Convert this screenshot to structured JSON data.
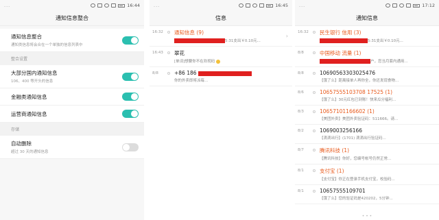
{
  "screen1": {
    "status": {
      "left": "...",
      "time": "16:44"
    },
    "title": "通知信息整合",
    "rows": [
      {
        "title": "通知信息整合",
        "sub": "通知类信息将会合在一个单独的信息列表中",
        "toggle": "on"
      }
    ],
    "section_merge": "整合设置",
    "merge_rows": [
      {
        "title": "大部分国内通知信息",
        "sub": "106、400 等开头的信息",
        "toggle": "on"
      },
      {
        "title": "金融类通知信息",
        "sub": "",
        "toggle": "on"
      },
      {
        "title": "运营商通知信息",
        "sub": "",
        "toggle": "on"
      }
    ],
    "section_storage": "存储",
    "storage_rows": [
      {
        "title": "自动删除",
        "sub": "超过 30 天的通知信息",
        "toggle": "off"
      }
    ]
  },
  "screen2": {
    "status": {
      "left": "...",
      "time": "16:45"
    },
    "title": "信息",
    "messages": [
      {
        "date": "16:32",
        "sender": "通知信息 (9)",
        "preview_suffix": "5:31支出￥0.10元...",
        "orange": true,
        "redact_sender": true,
        "redact_preview": true,
        "chevron": "›"
      },
      {
        "date": "16:43",
        "sender": "翠花",
        "preview": "[单词]想要你不在欢视码",
        "orange": false,
        "emoji": true
      },
      {
        "date": "8/8",
        "sender": "+86 186",
        "preview": "你的外卖即将派每...",
        "orange": false,
        "redact_sender_tail": true
      }
    ]
  },
  "screen3": {
    "status": {
      "left": "...",
      "time": "17:12"
    },
    "title": "通知信息",
    "messages": [
      {
        "date": "16:32",
        "sender": "民生银行 信用 (3)",
        "preview": "5:31支出￥0.10元...",
        "orange": true,
        "redact_preview": true
      },
      {
        "date": "8/8",
        "sender": "中国移动 流量 (1)",
        "preview": "户，您当月套内通用...",
        "orange": true,
        "redact_preview": true
      },
      {
        "date": "8/8",
        "sender": "10690563303025476",
        "preview": "【饿了么】距离接单人再你全，你还发现食物...",
        "orange": false
      },
      {
        "date": "8/6",
        "sender": "10657555103708 17525 (1)",
        "preview": "【饿了么】30元红包已到账！快来瓜分福利...",
        "orange": true
      },
      {
        "date": "8/3",
        "sender": "10657101166602 (1)",
        "preview": "【美团外卖】美团外卖验证码：511666。请...",
        "orange": true
      },
      {
        "date": "8/2",
        "sender": "1069003256166",
        "preview": "【滴滴出行】(1701) 滴滴出行验证码...",
        "orange": false
      },
      {
        "date": "8/7",
        "sender": "腾讯科技 (1)",
        "preview": "【腾讯科技】你好，您编号帐号仍然正常...",
        "orange": true
      },
      {
        "date": "8/1",
        "sender": "支付宝 (1)",
        "preview": "【支付宝】你正在登录手机支付宝，校验码...",
        "orange": true
      },
      {
        "date": "8/1",
        "sender": "10657555109701",
        "preview": "【饿了么】您的验证码是420202，5分钟...",
        "orange": false
      }
    ],
    "bottom": "• • •"
  }
}
